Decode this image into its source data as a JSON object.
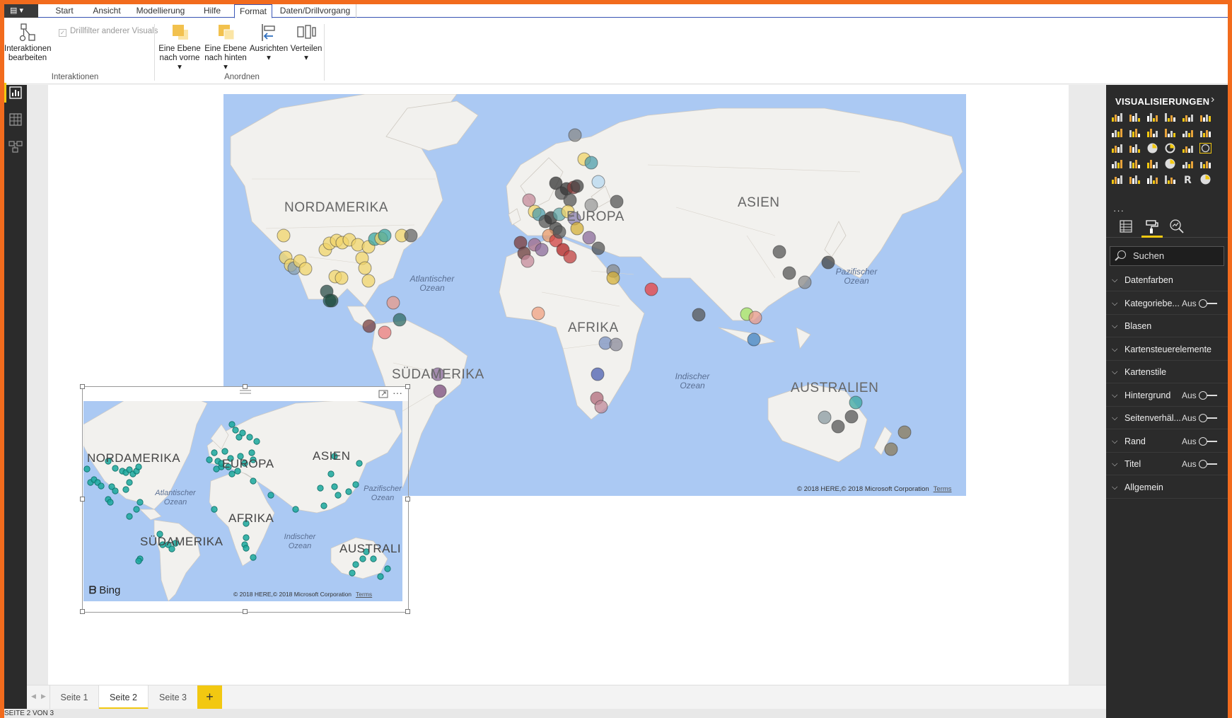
{
  "ribbon": {
    "file_menu_label": "▤ ▾",
    "tabs": [
      {
        "label": "Start"
      },
      {
        "label": "Ansicht"
      },
      {
        "label": "Modellierung"
      },
      {
        "label": "Hilfe"
      },
      {
        "label": "Format"
      },
      {
        "label": "Daten/Drillvorgang"
      }
    ],
    "active_tab": "Format",
    "buttons": {
      "edit_interactions": "Interaktionen bearbeiten",
      "drillfilter": "Drillfilter anderer Visuals",
      "bring_forward": "Eine Ebene nach vorne ▾",
      "send_backward": "Eine Ebene nach hinten ▾",
      "align": "Ausrichten ▾",
      "distribute": "Verteilen ▾"
    },
    "groups": {
      "interactions": "Interaktionen",
      "arrange": "Anordnen"
    }
  },
  "big_map": {
    "continents": [
      "NORDAMERIKA",
      "EUROPA",
      "ASIEN",
      "AFRIKA",
      "SÜDAMERIKA",
      "AUSTRALIEN"
    ],
    "oceans": [
      "Atlantischer Ozean",
      "Pazifischer Ozean",
      "Indischer Ozean"
    ],
    "copyright": "© 2018 HERE,© 2018 Microsoft Corporation",
    "terms": "Terms"
  },
  "mini_map": {
    "continents": [
      "NORDAMERIKA",
      "EUROPA",
      "ASIEN",
      "AFRIKA",
      "SÜDAMERIKA",
      "AUSTRALI"
    ],
    "oceans": [
      "Atlantischer Ozean",
      "Pazifischer Ozean",
      "Indischer Ozean"
    ],
    "copyright": "© 2018 HERE,© 2018 Microsoft Corporation",
    "terms": "Terms",
    "brand": "Bing",
    "bubble_color": "#1aa89c",
    "more_options": "···"
  },
  "pages": {
    "tabs": [
      "Seite 1",
      "Seite 2",
      "Seite 3"
    ],
    "active": "Seite 2",
    "add": "+"
  },
  "status": "SEITE 2 VON 3",
  "pane": {
    "title": "VISUALISIERUNGEN",
    "more": "···",
    "search_placeholder": "Suchen",
    "sections": [
      {
        "label": "Datenfarben",
        "state": "",
        "toggle": false
      },
      {
        "label": "Kategoriebe...",
        "state": "Aus",
        "toggle": true
      },
      {
        "label": "Blasen",
        "state": "",
        "toggle": false
      },
      {
        "label": "Kartensteuerelemente",
        "state": "",
        "toggle": false
      },
      {
        "label": "Kartenstile",
        "state": "",
        "toggle": false
      },
      {
        "label": "Hintergrund",
        "state": "Aus",
        "toggle": true
      },
      {
        "label": "Seitenverhäl...",
        "state": "Aus",
        "toggle": true
      },
      {
        "label": "Rand",
        "state": "Aus",
        "toggle": true
      },
      {
        "label": "Titel",
        "state": "Aus",
        "toggle": true
      },
      {
        "label": "Allgemein",
        "state": "",
        "toggle": false
      }
    ]
  },
  "colors": {
    "accent_yellow": "#f2c811",
    "ribbon_blue": "#3c58b8",
    "pane_dark": "#2b2b2b",
    "ocean": "#abc9f3",
    "land": "#f2f1ee"
  }
}
